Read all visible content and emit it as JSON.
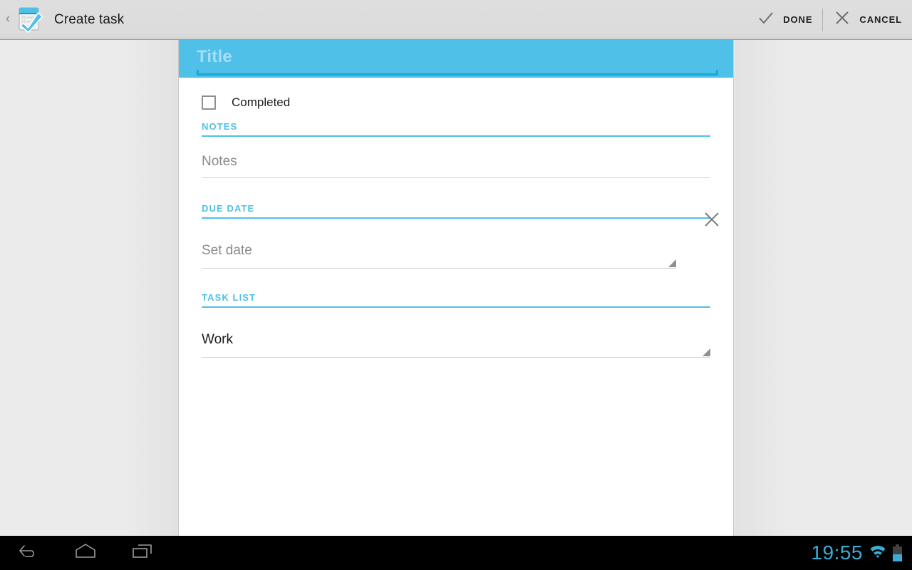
{
  "action_bar": {
    "up_chevron": "‹",
    "icon_name": "tasks-app-icon",
    "title": "Create task",
    "actions": [
      {
        "id": "done",
        "icon": "check-icon",
        "label": "DONE"
      },
      {
        "id": "cancel",
        "icon": "close-icon",
        "label": "CANCEL"
      }
    ]
  },
  "form": {
    "title_field": {
      "placeholder": "Title",
      "value": ""
    },
    "completed": {
      "label": "Completed",
      "checked": false
    },
    "sections": {
      "notes": {
        "header": "NOTES",
        "placeholder": "Notes",
        "value": ""
      },
      "due_date": {
        "header": "DUE DATE",
        "placeholder": "Set date",
        "value": "",
        "clear_icon": "close-icon"
      },
      "task_list": {
        "header": "TASK LIST",
        "value": "Work"
      }
    }
  },
  "nav_bar": {
    "buttons": [
      {
        "id": "back",
        "icon": "back-arrow-icon"
      },
      {
        "id": "home",
        "icon": "home-icon"
      },
      {
        "id": "recents",
        "icon": "recents-icon"
      }
    ],
    "status": {
      "clock": "19:55",
      "wifi_icon": "wifi-icon",
      "battery_icon": "battery-icon"
    }
  },
  "colors": {
    "accent": "#4fc0e8",
    "accent_dark": "#1aa8db",
    "status_blue": "#3badd4",
    "action_bar_bg": "#dcdcdc",
    "page_bg": "#ebebeb",
    "card_bg": "#ffffff"
  }
}
